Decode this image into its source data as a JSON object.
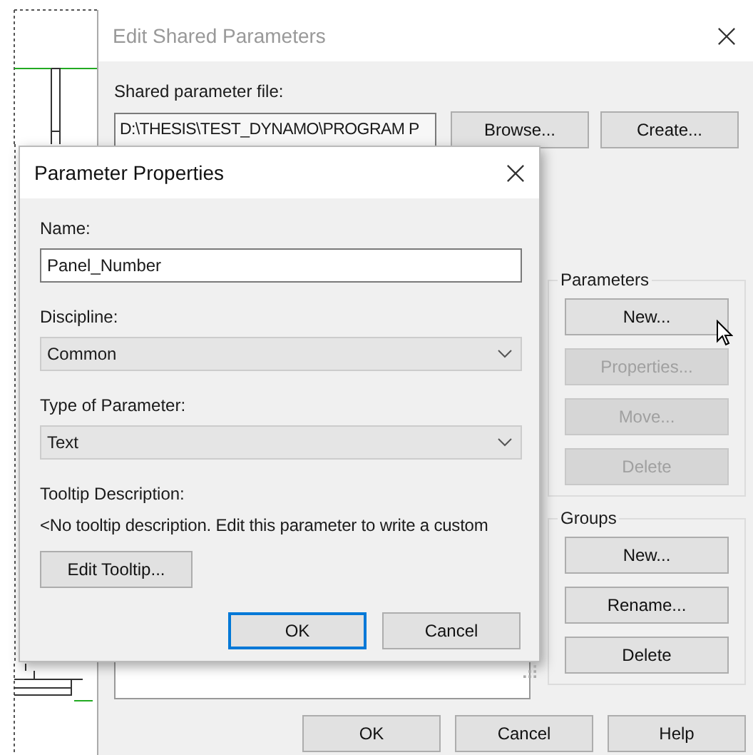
{
  "main_window": {
    "title": "Edit Shared Parameters",
    "active": false,
    "file_label": "Shared parameter file:",
    "file_path": "D:\\THESIS\\TEST_DYNAMO\\PROGRAM P",
    "file_buttons": [
      {
        "label": "Browse...",
        "disabled": false
      },
      {
        "label": "Create...",
        "disabled": false
      }
    ],
    "groups": [
      {
        "title": "Parameters",
        "buttons": [
          {
            "label": "New...",
            "disabled": false
          },
          {
            "label": "Properties...",
            "disabled": true
          },
          {
            "label": "Move...",
            "disabled": true
          },
          {
            "label": "Delete",
            "disabled": true
          }
        ]
      },
      {
        "title": "Groups",
        "buttons": [
          {
            "label": "New...",
            "disabled": false
          },
          {
            "label": "Rename...",
            "disabled": false
          },
          {
            "label": "Delete",
            "disabled": false
          }
        ]
      }
    ],
    "footer_buttons": [
      {
        "label": "OK",
        "disabled": false
      },
      {
        "label": "Cancel",
        "disabled": false
      },
      {
        "label": "Help",
        "disabled": false
      }
    ]
  },
  "dialog": {
    "title": "Parameter Properties",
    "active": true,
    "fields": [
      {
        "kind": "text",
        "label": "Name:",
        "value": "Panel_Number"
      },
      {
        "kind": "dropdown",
        "label": "Discipline:",
        "value": "Common"
      },
      {
        "kind": "dropdown",
        "label": "Type of Parameter:",
        "value": "Text"
      }
    ],
    "tooltip_label": "Tooltip Description:",
    "tooltip_text": "<No tooltip description. Edit this parameter to write a custom",
    "edit_button": "Edit Tooltip...",
    "buttons": [
      {
        "label": "OK",
        "focused": true
      },
      {
        "label": "Cancel",
        "focused": false
      }
    ]
  }
}
